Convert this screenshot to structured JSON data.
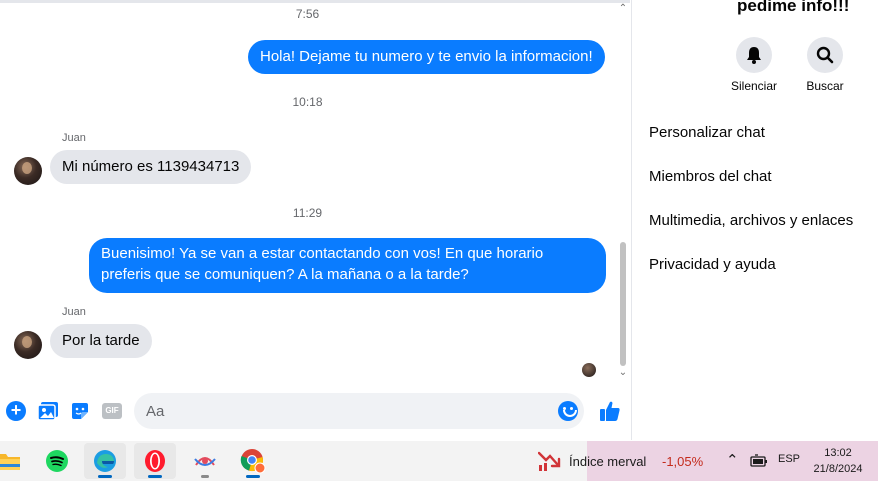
{
  "conversation": {
    "messages": [
      {
        "time": "7:56"
      },
      {
        "direction": "outgoing",
        "text": "Hola! Dejame tu numero y te envio la informacion!"
      },
      {
        "time": "10:18"
      },
      {
        "direction": "incoming",
        "sender": "Juan",
        "text": "Mi número es 1139434713"
      },
      {
        "time": "11:29"
      },
      {
        "direction": "outgoing",
        "text": "Buenisimo! Ya se van a estar contactando con vos! En que horario preferis que se comuniquen? A la mañana o a la tarde?"
      },
      {
        "direction": "incoming",
        "sender": "Juan",
        "text": "Por la tarde"
      }
    ]
  },
  "composer": {
    "placeholder": "Aa",
    "icons": [
      "plus-circle-icon",
      "image-icon",
      "sticker-icon",
      "gif-icon",
      "emoji-icon",
      "like-icon"
    ]
  },
  "panel": {
    "title": "pedime info!!!",
    "actions": [
      {
        "label": "Silenciar",
        "icon": "bell-icon"
      },
      {
        "label": "Buscar",
        "icon": "search-icon"
      }
    ],
    "menu": [
      "Personalizar chat",
      "Miembros del chat",
      "Multimedia, archivos y enlaces",
      "Privacidad y ayuda"
    ]
  },
  "taskbar": {
    "apps": [
      "file-explorer-icon",
      "spotify-icon",
      "edge-icon",
      "opera-icon",
      "app-icon",
      "chrome-icon"
    ],
    "widget": {
      "name": "Índice merval",
      "change": "-1,05%"
    },
    "tray": {
      "language": "ESP"
    },
    "clock": {
      "time": "13:02",
      "date": "21/8/2024"
    }
  },
  "colors": {
    "messenger_blue": "#0a7cff",
    "incoming_bubble": "#e4e6eb",
    "stock_down": "#c42b1c",
    "widget_bg": "#ecd3e3"
  }
}
